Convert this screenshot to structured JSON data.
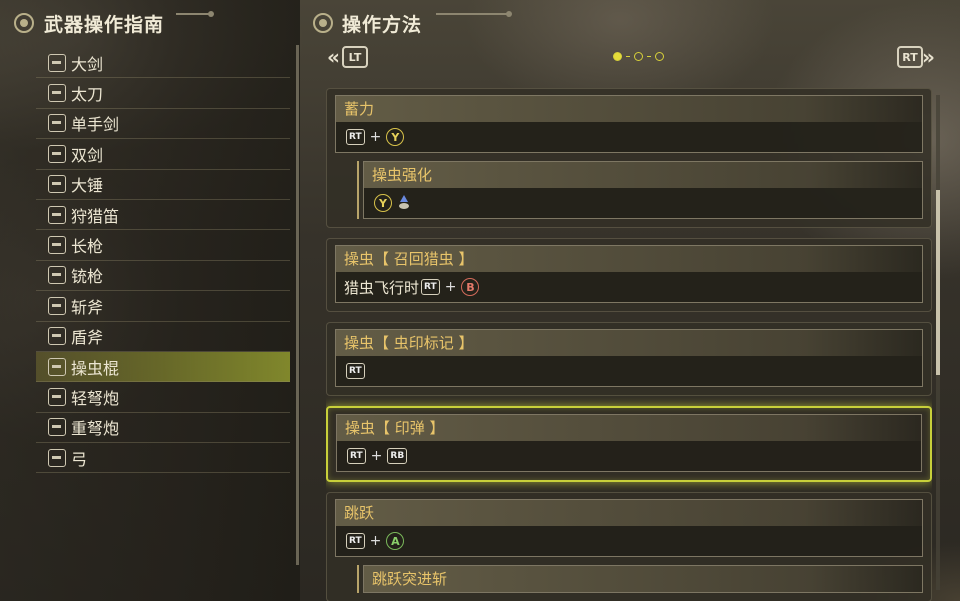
{
  "left_panel": {
    "title": "武器操作指南",
    "weapons": [
      {
        "label": "大剑",
        "icon": "great-sword-icon",
        "selected": false
      },
      {
        "label": "太刀",
        "icon": "long-sword-icon",
        "selected": false
      },
      {
        "label": "单手剑",
        "icon": "sword-and-shield-icon",
        "selected": false
      },
      {
        "label": "双剑",
        "icon": "dual-blades-icon",
        "selected": false
      },
      {
        "label": "大锤",
        "icon": "hammer-icon",
        "selected": false
      },
      {
        "label": "狩猎笛",
        "icon": "hunting-horn-icon",
        "selected": false
      },
      {
        "label": "长枪",
        "icon": "lance-icon",
        "selected": false
      },
      {
        "label": "铳枪",
        "icon": "gunlance-icon",
        "selected": false
      },
      {
        "label": "斩斧",
        "icon": "switch-axe-icon",
        "selected": false
      },
      {
        "label": "盾斧",
        "icon": "charge-blade-icon",
        "selected": false
      },
      {
        "label": "操虫棍",
        "icon": "insect-glaive-icon",
        "selected": true
      },
      {
        "label": "轻弩炮",
        "icon": "light-bowgun-icon",
        "selected": false
      },
      {
        "label": "重弩炮",
        "icon": "heavy-bowgun-icon",
        "selected": false
      },
      {
        "label": "弓",
        "icon": "bow-icon",
        "selected": false
      }
    ]
  },
  "right_panel": {
    "title": "操作方法",
    "prev_button": "LT",
    "next_button": "RT",
    "page_indicator": {
      "current": 1,
      "total": 3
    },
    "colors": {
      "highlight": "#c8d03a",
      "entry_title": "#e8c46a"
    }
  },
  "buttons": {
    "rt": "RT",
    "rb": "RB",
    "y": "Y",
    "b": "B",
    "a": "A",
    "plus": "+"
  },
  "cards": {
    "c1": {
      "title": "蓄力",
      "sub_title": "操虫强化"
    },
    "c2": {
      "title": "操虫【 召回猎虫 】",
      "prefix": "猎虫飞行时"
    },
    "c3": {
      "title": "操虫【 虫印标记 】"
    },
    "c4": {
      "title": "操虫【 印弹 】"
    },
    "c5": {
      "title": "跳跃",
      "sub_title": "跳跃突进斩"
    }
  }
}
